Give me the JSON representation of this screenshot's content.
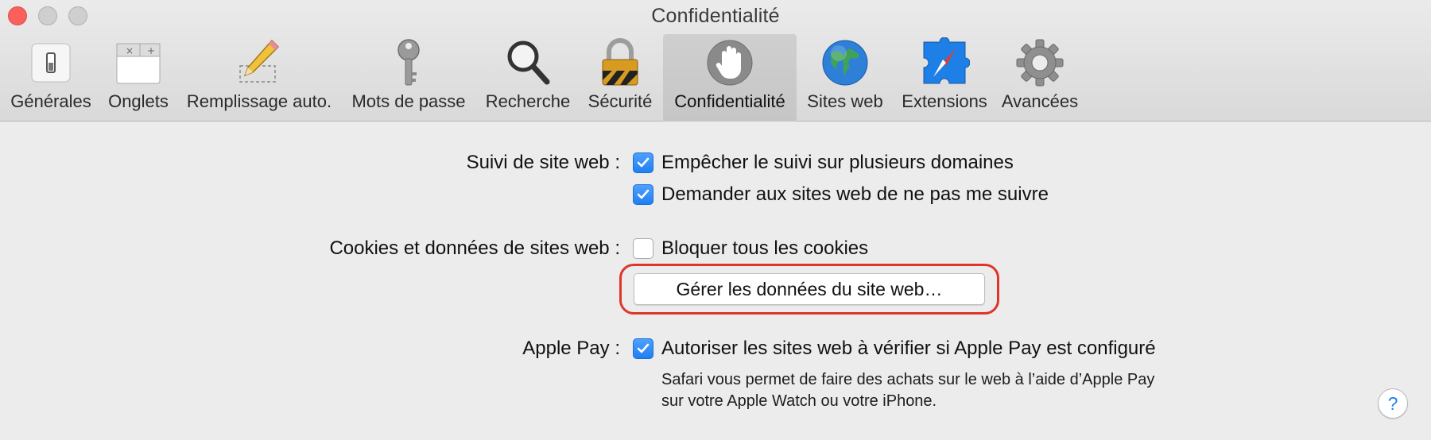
{
  "window": {
    "title": "Confidentialité"
  },
  "toolbar": {
    "tabs": [
      {
        "label": "Générales",
        "icon": "switch-icon"
      },
      {
        "label": "Onglets",
        "icon": "tabs-icon"
      },
      {
        "label": "Remplissage auto.",
        "icon": "pencil-icon"
      },
      {
        "label": "Mots de passe",
        "icon": "key-icon"
      },
      {
        "label": "Recherche",
        "icon": "magnifier-icon"
      },
      {
        "label": "Sécurité",
        "icon": "padlock-icon"
      },
      {
        "label": "Confidentialité",
        "icon": "hand-icon",
        "selected": true
      },
      {
        "label": "Sites web",
        "icon": "globe-icon"
      },
      {
        "label": "Extensions",
        "icon": "puzzle-compass-icon"
      },
      {
        "label": "Avancées",
        "icon": "gear-icon"
      }
    ]
  },
  "tracking": {
    "label": "Suivi de site web :",
    "options": [
      {
        "label": "Empêcher le suivi sur plusieurs domaines",
        "checked": true
      },
      {
        "label": "Demander aux sites web de ne pas me suivre",
        "checked": true
      }
    ]
  },
  "cookies": {
    "label": "Cookies et données de sites web :",
    "block_all": {
      "label": "Bloquer tous les cookies",
      "checked": false
    },
    "manage_button": "Gérer les données du site web…"
  },
  "apple_pay": {
    "label": "Apple Pay :",
    "option": {
      "label": "Autoriser les sites web à vérifier si Apple Pay est configuré",
      "checked": true
    },
    "description_line1": "Safari vous permet de faire des achats sur le web à l’aide d’Apple Pay",
    "description_line2": "sur votre Apple Watch ou votre iPhone."
  },
  "help": {
    "label": "?"
  },
  "colors": {
    "accent": "#1f7ff1",
    "highlight": "#e0352b",
    "close_light": "#fc605b",
    "background": "#ececec"
  }
}
